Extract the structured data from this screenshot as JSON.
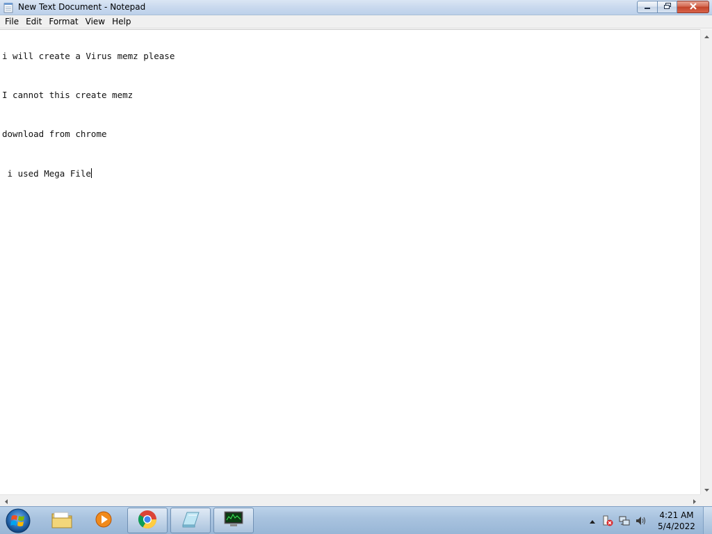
{
  "window": {
    "title": "New Text Document - Notepad",
    "icon": "notepad-icon"
  },
  "caption_buttons": {
    "minimize_icon": "minimize-icon",
    "restore_icon": "restore-icon",
    "close_icon": "close-icon"
  },
  "menu": {
    "items": [
      {
        "label": "File"
      },
      {
        "label": "Edit"
      },
      {
        "label": "Format"
      },
      {
        "label": "View"
      },
      {
        "label": "Help"
      }
    ]
  },
  "document": {
    "lines": [
      "i will create a Virus memz please",
      "I cannot this create memz",
      "download from chrome",
      " i used Mega File"
    ]
  },
  "taskbar": {
    "items": [
      "windows-explorer-icon",
      "media-player-icon",
      "chrome-icon",
      "notepad-icon",
      "task-manager-icon"
    ],
    "clock": {
      "time": "4:21 AM",
      "date": "5/4/2022"
    }
  },
  "colors": {
    "titlebar": "#c9d9ee",
    "close_button": "#c2442a",
    "taskbar": "#a9c3df"
  }
}
